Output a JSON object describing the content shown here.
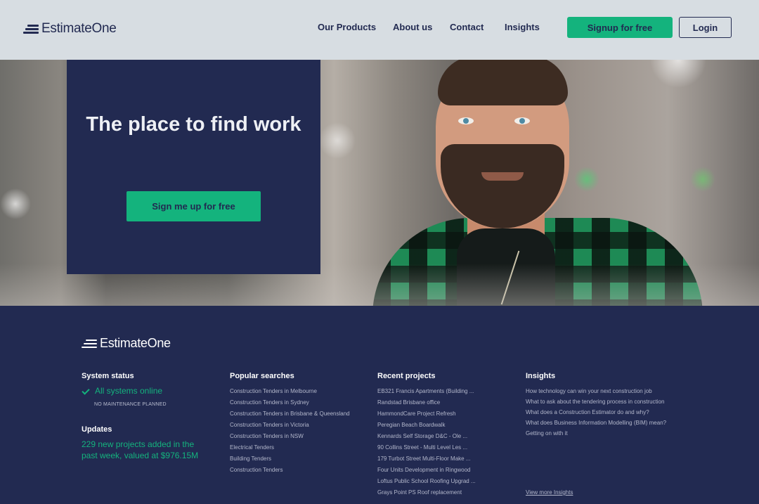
{
  "header": {
    "brand": "EstimateOne",
    "nav": [
      "Our Products",
      "About us",
      "Contact",
      "Insights"
    ],
    "signup_label": "Signup for free",
    "login_label": "Login"
  },
  "hero": {
    "title": "The place to find work",
    "cta_label": "Sign me up for free"
  },
  "footer": {
    "brand": "EstimateOne",
    "status": {
      "heading": "System status",
      "state": "All systems online",
      "maintenance": "NO MAINTENANCE PLANNED"
    },
    "updates": {
      "heading": "Updates",
      "text": "229 new projects added in the past week, valued at $976.15M"
    },
    "popular": {
      "heading": "Popular searches",
      "items": [
        "Construction Tenders in Melbourne",
        "Construction Tenders in Sydney",
        "Construction Tenders in Brisbane & Queensland",
        "Construction Tenders in Victoria",
        "Construction Tenders in NSW",
        "Electrical Tenders",
        "Building Tenders",
        "Construction Tenders"
      ]
    },
    "recent": {
      "heading": "Recent projects",
      "items": [
        "EB321 Francis Apartments (Building ...",
        "Randstad Brisbane office",
        "HammondCare Project Refresh",
        "Peregian Beach Boardwalk",
        "Kennards Self Storage D&C - Ole ...",
        "90 Collins Street - Multi Level Les ...",
        "179 Turbot Street Multi-Floor Make ...",
        "Four Units Development in Ringwood",
        "Loftus Public School Roofing Upgrad ...",
        "Grays Point PS Roof replacement"
      ]
    },
    "insights": {
      "heading": "Insights",
      "items": [
        "How technology can win your next construction job",
        "What to ask about the tendering process in construction",
        "What does a Construction Estimator do and why?",
        "What does Business Information Modelling (BIM) mean?",
        "Getting on with it"
      ],
      "view_more": "View more Insights"
    }
  },
  "colors": {
    "navy": "#222a51",
    "green": "#14b37d",
    "header_bg": "#d7dde2"
  }
}
